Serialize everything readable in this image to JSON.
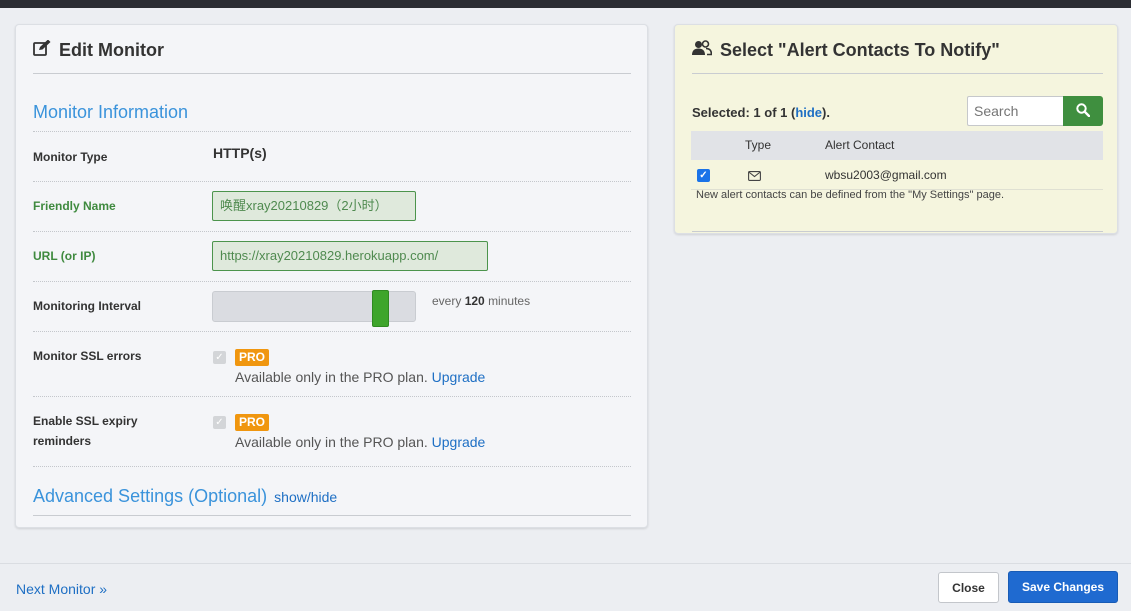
{
  "edit_panel": {
    "title": "Edit Monitor",
    "section_title": "Monitor Information",
    "fields": {
      "monitor_type": {
        "label": "Monitor Type",
        "value": "HTTP(s)"
      },
      "friendly_name": {
        "label": "Friendly Name",
        "value": "唤醒xray20210829（2小时）"
      },
      "url": {
        "label": "URL (or IP)",
        "value": "https://xray20210829.herokuapp.com/"
      },
      "interval": {
        "label": "Monitoring Interval",
        "prefix": "every",
        "value": "120",
        "suffix": "minutes",
        "slider_fraction": 0.86
      },
      "ssl_errors": {
        "label": "Monitor SSL errors",
        "badge": "PRO",
        "note": "Available only in the PRO plan.",
        "link": "Upgrade"
      },
      "ssl_expiry": {
        "label_line1": "Enable SSL expiry",
        "label_line2": "reminders",
        "badge": "PRO",
        "note": "Available only in the PRO plan.",
        "link": "Upgrade"
      }
    },
    "advanced": {
      "title": "Advanced Settings (Optional)",
      "toggle": "show/hide"
    }
  },
  "contacts_panel": {
    "title": "Select \"Alert Contacts To Notify\"",
    "selected_prefix": "Selected: 1 of 1 (",
    "hide_link": "hide",
    "selected_suffix": ").",
    "search_placeholder": "Search",
    "columns": {
      "type": "Type",
      "contact": "Alert Contact"
    },
    "rows": [
      {
        "checked": true,
        "type_icon": "envelope-icon",
        "contact": "wbsu2003@gmail.com"
      }
    ],
    "note": "New alert contacts can be defined from the \"My Settings\" page."
  },
  "footer": {
    "next_monitor": "Next Monitor »",
    "close": "Close",
    "save": "Save Changes"
  },
  "colors": {
    "accent_blue": "#3a93db",
    "link_blue": "#1e6fc4",
    "valid_green": "#3f8a3f",
    "slider_green": "#3ea52b",
    "pro_orange": "#f0960f",
    "save_blue": "#1f6ad0"
  }
}
